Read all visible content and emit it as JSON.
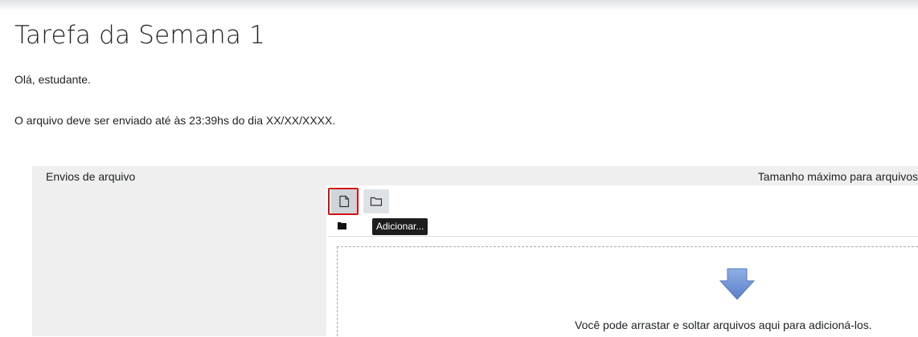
{
  "assignment": {
    "title": "Tarefa da Semana 1",
    "greeting": "Olá, estudante.",
    "deadline_text": "O arquivo deve ser enviado até às 23:39hs do dia XX/XX/XXXX."
  },
  "file_submission": {
    "label": "Envios de arquivo",
    "max_size_text": "Tamanho máximo para arquivos",
    "toolbar": {
      "add_tooltip": "Adicionar..."
    },
    "drop_message": "Você pode arrastar e soltar arquivos aqui para adicioná-los."
  },
  "icons": {
    "add": "file-icon",
    "create_folder": "folder-icon",
    "path": "folder-filled-icon",
    "drop": "down-arrow-icon"
  },
  "colors": {
    "highlight": "#d40f0f",
    "tooltip_bg": "#1d1d1d",
    "arrow": "#6f95d6"
  }
}
